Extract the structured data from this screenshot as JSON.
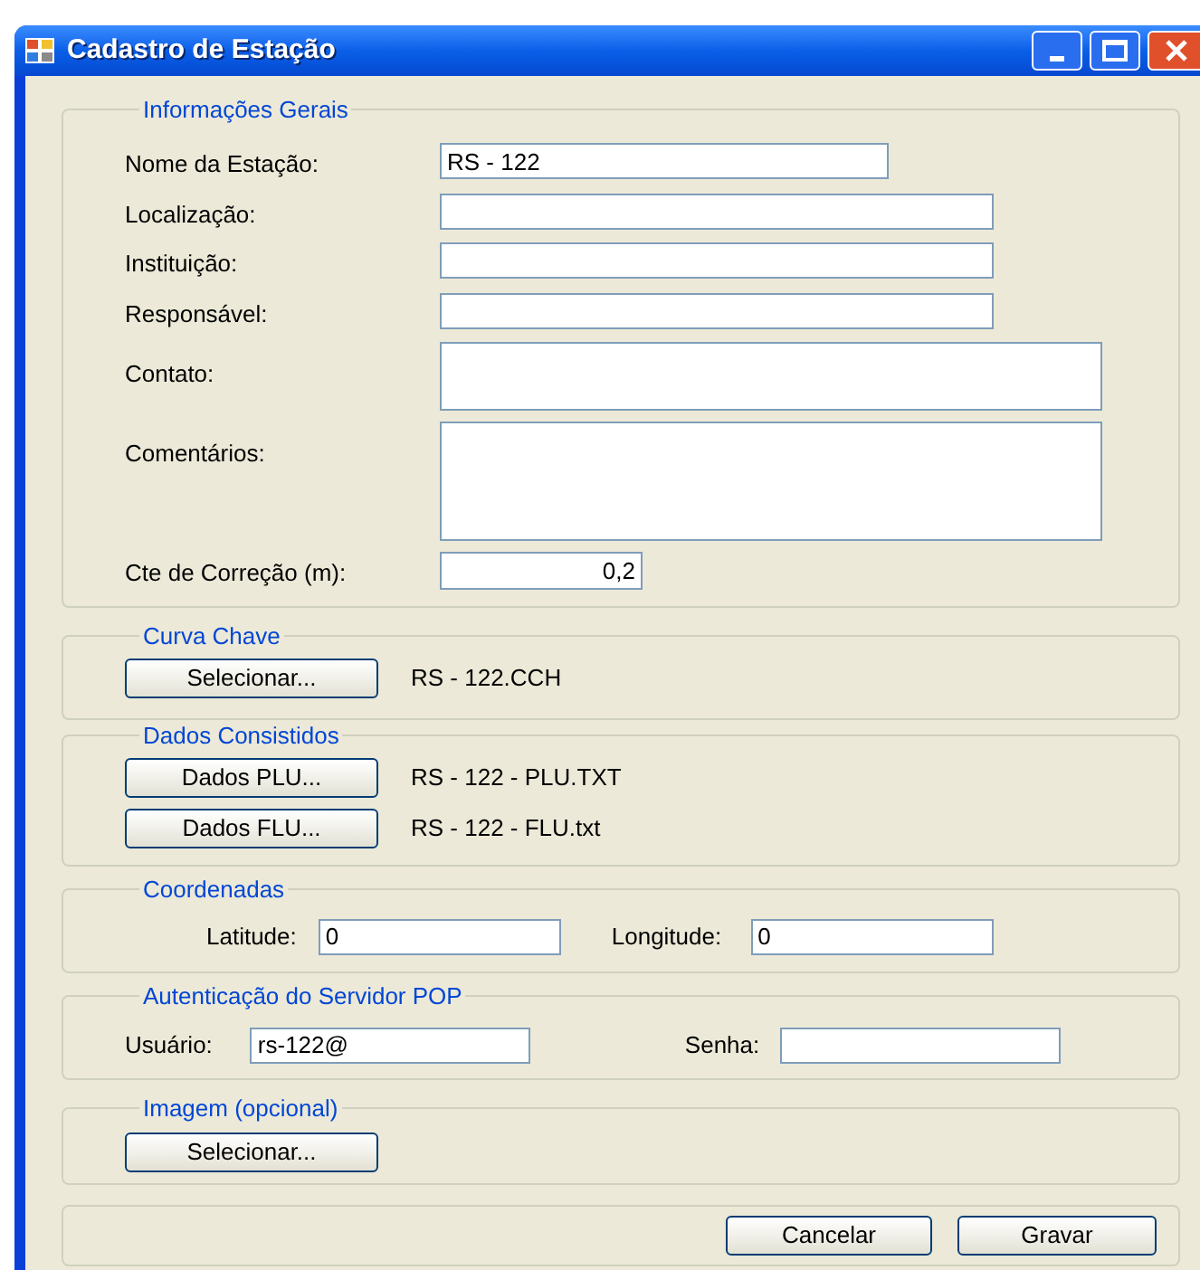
{
  "window": {
    "title": "Cadastro de Estação"
  },
  "informacoes_gerais": {
    "title": "Informações Gerais",
    "fields": [
      {
        "label": "Nome da Estação:",
        "value": "RS - 122",
        "kind": "short"
      },
      {
        "label": "Localização:",
        "kind": "text"
      },
      {
        "label": "Instituição:",
        "kind": "text"
      },
      {
        "label": "Responsável:",
        "kind": "text"
      },
      {
        "label": "Contato:",
        "kind": "multiline"
      },
      {
        "label": "Comentários:",
        "kind": "multiline_tall"
      },
      {
        "label": "Cte de Correção (m):",
        "value": "0,2",
        "kind": "number"
      }
    ]
  },
  "curva_chave": {
    "title": "Curva Chave",
    "button": "Selecionar...",
    "file": "RS - 122.CCH"
  },
  "dados_consistidos": {
    "title": "Dados Consistidos",
    "rows": [
      {
        "button": "Dados PLU...",
        "file": "RS - 122 - PLU.TXT"
      },
      {
        "button": "Dados FLU...",
        "file": "RS - 122 - FLU.txt"
      }
    ]
  },
  "coordenadas": {
    "title": "Coordenadas",
    "fields": [
      {
        "label": "Latitude:",
        "value": "0"
      },
      {
        "label": "Longitude:",
        "value": "0"
      }
    ]
  },
  "autenticacao": {
    "title": "Autenticação do Servidor POP",
    "fields": [
      {
        "label": "Usuário:",
        "value": "rs-122@"
      },
      {
        "label": "Senha:"
      }
    ]
  },
  "imagem": {
    "title": "Imagem (opcional)",
    "button": "Selecionar..."
  },
  "buttons": [
    "Cancelar",
    "Gravar"
  ]
}
